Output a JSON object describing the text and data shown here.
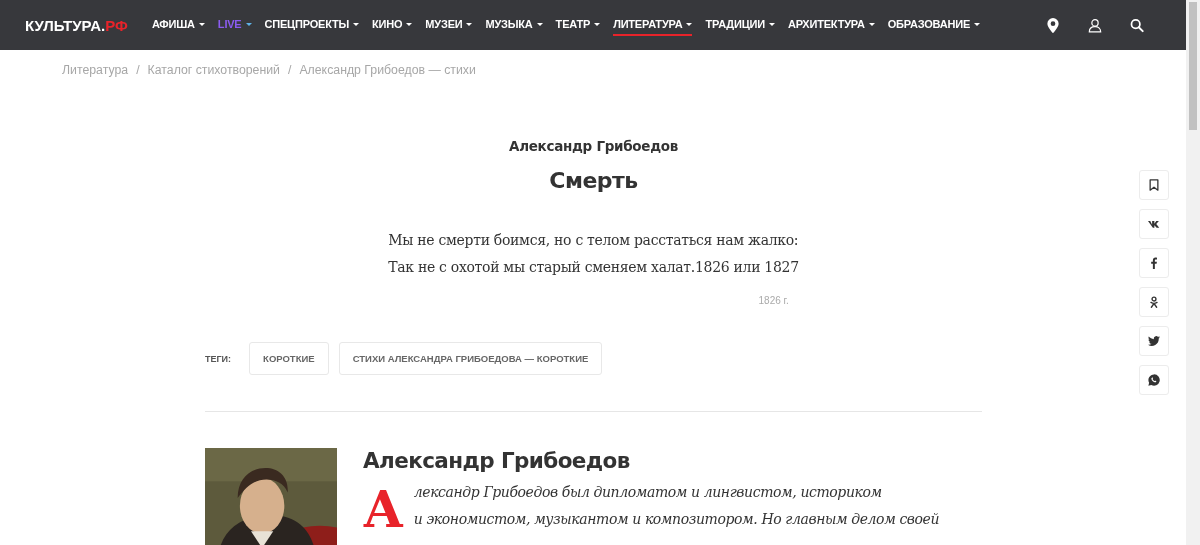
{
  "header": {
    "logo": {
      "name": "КУЛЬТУРА.",
      "suffix": "РФ"
    },
    "nav": [
      {
        "label": "АФИША",
        "selected": false,
        "color": "#ffffff"
      },
      {
        "label": "LIVE",
        "selected": false,
        "color": "#8b5cf0"
      },
      {
        "label": "СПЕЦПРОЕКТЫ",
        "selected": false,
        "color": "#ffffff"
      },
      {
        "label": "КИНО",
        "selected": false,
        "color": "#ffffff"
      },
      {
        "label": "МУЗЕИ",
        "selected": false,
        "color": "#ffffff"
      },
      {
        "label": "МУЗЫКА",
        "selected": false,
        "color": "#ffffff"
      },
      {
        "label": "ТЕАТР",
        "selected": false,
        "color": "#ffffff"
      },
      {
        "label": "ЛИТЕРАТУРА",
        "selected": true,
        "color": "#ffffff"
      },
      {
        "label": "ТРАДИЦИИ",
        "selected": false,
        "color": "#ffffff"
      },
      {
        "label": "АРХИТЕКТУРА",
        "selected": false,
        "color": "#ffffff"
      },
      {
        "label": "ОБРАЗОВАНИЕ",
        "selected": false,
        "color": "#ffffff"
      }
    ]
  },
  "breadcrumbs": {
    "separator": "/",
    "items": [
      "Литература",
      "Каталог стихотворений",
      "Александр Грибоедов — стихи"
    ]
  },
  "poem": {
    "author": "Александр Грибоедов",
    "title": "Смерть",
    "lines": [
      "Мы не смерти боимся, но с телом расстаться нам жалко:",
      "Так не с охотой мы старый сменяем халат.1826 или 1827"
    ],
    "date": "1826 г."
  },
  "tags": {
    "label": "ТЕГИ:",
    "items": [
      "КОРОТКИЕ",
      "СТИХИ АЛЕКСАНДРА ГРИБОЕДОВА — КОРОТКИЕ"
    ]
  },
  "share": [
    {
      "kind": "bookmark"
    },
    {
      "kind": "vk"
    },
    {
      "kind": "facebook"
    },
    {
      "kind": "ok"
    },
    {
      "kind": "twitter"
    },
    {
      "kind": "whatsapp"
    }
  ],
  "author_bio": {
    "name": "Александр Грибоедов",
    "drop_cap": "А",
    "lines": [
      "лександр Грибоедов был дипломатом и лингвистом, историком",
      "и экономистом, музыкантом и композитором. Но главным делом своей"
    ]
  }
}
